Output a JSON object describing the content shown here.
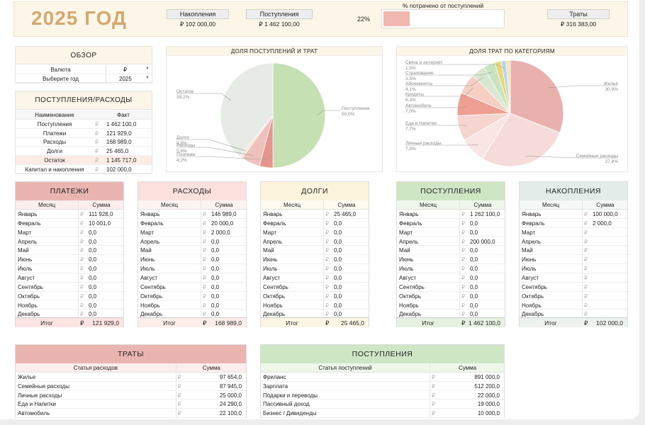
{
  "header": {
    "year_title": "2025 ГОД",
    "savings_label": "Накопления",
    "savings_value": "₽ 102 000,00",
    "income_label": "Поступления",
    "income_value": "₽ 1 462 100,00",
    "pct_value": "22%",
    "pct_label": "% потрачено от поступлений",
    "pct_fraction": 0.22,
    "spend_label": "Траты",
    "spend_value": "₽ 316 383,00"
  },
  "overview": {
    "title": "ОБЗОР",
    "currency_label": "Валюта",
    "currency_value": "₽",
    "year_label": "Выберите год",
    "year_value": "2025"
  },
  "summary": {
    "title": "ПОСТУПЛЕНИЯ/РАСХОДЫ",
    "col_name": "Наименование",
    "col_fact": "Факт",
    "cur": "₽",
    "rows": [
      {
        "name": "Поступления",
        "value": "1 462 100,0"
      },
      {
        "name": "Платежи",
        "value": "121 929,0"
      },
      {
        "name": "Расходы",
        "value": "168 989,0"
      },
      {
        "name": "Долги",
        "value": "25 465,0"
      },
      {
        "name": "Остаток",
        "value": "1 145 717,0"
      },
      {
        "name": "Капитал и накопления",
        "value": "102 000,0"
      }
    ]
  },
  "pie1": {
    "title": "ДОЛЯ ПОСТУПЛЕНИЙ И ТРАТ",
    "slices": [
      {
        "name": "Поступления",
        "pct": "50,0%",
        "value": 50.0,
        "color": "#c5e0b3"
      },
      {
        "name": "Платежи",
        "pct": "4,2%",
        "value": 4.2,
        "color": "#e4958f"
      },
      {
        "name": "Расходы",
        "pct": "5,8%",
        "value": 5.8,
        "color": "#f0c1bb"
      },
      {
        "name": "Долги",
        "pct": "0,9%",
        "value": 0.9,
        "color": "#f7e3d8"
      },
      {
        "name": "Остаток",
        "pct": "39,2%",
        "value": 39.2,
        "color": "#e6ebe6"
      }
    ]
  },
  "pie2": {
    "title": "ДОЛЯ ТРАТ ПО КАТЕГОРИЯМ",
    "slices": [
      {
        "name": "Жильё",
        "pct": "30,9%",
        "value": 30.9,
        "color": "#e8b1ad"
      },
      {
        "name": "Семейные расходы",
        "pct": "27,8%",
        "value": 27.8,
        "color": "#f5dcdb"
      },
      {
        "name": "Личные расходы",
        "pct": "7,9%",
        "value": 7.9,
        "color": "#f9e5e3"
      },
      {
        "name": "Еда и Напитки",
        "pct": "7,7%",
        "value": 7.7,
        "color": "#f6d4d0"
      },
      {
        "name": "Автомобиль",
        "pct": "7,0%",
        "value": 7.0,
        "color": "#ee9f92"
      },
      {
        "name": "Кредиты",
        "pct": "6,3%",
        "value": 6.3,
        "color": "#f4cfc2"
      },
      {
        "name": "Абонементы",
        "pct": "4,1%",
        "value": 4.1,
        "color": "#d8e8d0"
      },
      {
        "name": "Страхование",
        "pct": "3,5%",
        "value": 3.5,
        "color": "#c9e2c0"
      },
      {
        "name": "",
        "pct": "",
        "value": 2.0,
        "color": "#e9d77a"
      },
      {
        "name": "Связь и интернет",
        "pct": "1,5%",
        "value": 1.5,
        "color": "#b8d4ea"
      },
      {
        "name": "",
        "pct": "",
        "value": 1.3,
        "color": "#f1e6b5"
      }
    ]
  },
  "months_col": "Месяц",
  "sum_col": "Сумма",
  "total_label": "Итог",
  "cur": "₽",
  "tables": [
    {
      "title": "ПЛАТЕЖИ",
      "color": "#eab5b1",
      "thcolor": "#fbeeed",
      "totcolor": "#fbe4e2",
      "rows": [
        [
          "Январь",
          "111 928,0"
        ],
        [
          "Февраль",
          "10 001,0"
        ],
        [
          "Март",
          "0,0"
        ],
        [
          "Апрель",
          "0,0"
        ],
        [
          "Май",
          "0,0"
        ],
        [
          "Июнь",
          "0,0"
        ],
        [
          "Июль",
          "0,0"
        ],
        [
          "Август",
          "0,0"
        ],
        [
          "Сентябрь",
          "0,0"
        ],
        [
          "Октябрь",
          "0,0"
        ],
        [
          "Ноябрь",
          "0,0"
        ],
        [
          "Декабрь",
          "0,0"
        ]
      ],
      "total": "121 929,0"
    },
    {
      "title": "РАСХОДЫ",
      "color": "#fbe1dd",
      "thcolor": "#fdf4f2",
      "totcolor": "#fdeeea",
      "rows": [
        [
          "Январь",
          "146 989,0"
        ],
        [
          "Февраль",
          "20 000,0"
        ],
        [
          "Март",
          "2 000,0"
        ],
        [
          "Апрель",
          "0,0"
        ],
        [
          "Май",
          "0,0"
        ],
        [
          "Июнь",
          "0,0"
        ],
        [
          "Июль",
          "0,0"
        ],
        [
          "Август",
          "0,0"
        ],
        [
          "Сентябрь",
          "0,0"
        ],
        [
          "Октябрь",
          "0,0"
        ],
        [
          "Ноябрь",
          "0,0"
        ],
        [
          "Декабрь",
          "0,0"
        ]
      ],
      "total": "168 989,0"
    },
    {
      "title": "ДОЛГИ",
      "color": "#fcf3dc",
      "thcolor": "#fefaf0",
      "totcolor": "#fdf5e4",
      "rows": [
        [
          "Январь",
          "25 465,0"
        ],
        [
          "Февраль",
          "0,0"
        ],
        [
          "Март",
          "0,0"
        ],
        [
          "Апрель",
          "0,0"
        ],
        [
          "Май",
          "0,0"
        ],
        [
          "Июнь",
          "0,0"
        ],
        [
          "Июль",
          "0,0"
        ],
        [
          "Август",
          "0,0"
        ],
        [
          "Сентябрь",
          "0,0"
        ],
        [
          "Октябрь",
          "0,0"
        ],
        [
          "Ноябрь",
          "0,0"
        ],
        [
          "Декабрь",
          "0,0"
        ]
      ],
      "total": "25 465,0"
    },
    {
      "title": "ПОСТУПЛЕНИЯ",
      "color": "#cfe6c4",
      "thcolor": "#eef7ea",
      "totcolor": "#e6f1e0",
      "rows": [
        [
          "Январь",
          "1 262 100,0"
        ],
        [
          "Февраль",
          "0,0"
        ],
        [
          "Март",
          "0,0"
        ],
        [
          "Апрель",
          "200 000,0"
        ],
        [
          "Май",
          "0,0"
        ],
        [
          "Июнь",
          "0,0"
        ],
        [
          "Июль",
          "0,0"
        ],
        [
          "Август",
          "0,0"
        ],
        [
          "Сентябрь",
          "0,0"
        ],
        [
          "Октябрь",
          "0,0"
        ],
        [
          "Ноябрь",
          "0,0"
        ],
        [
          "Декабрь",
          "0,0"
        ]
      ],
      "total": "1 462 100,0"
    },
    {
      "title": "НАКОПЛЕНИЯ",
      "color": "#e3ece8",
      "thcolor": "#f4f8f6",
      "totcolor": "#edf2ef",
      "rows": [
        [
          "Январь",
          "100 000,0"
        ],
        [
          "Февраль",
          "2 000,0"
        ],
        [
          "Март",
          ""
        ],
        [
          "Апрель",
          ""
        ],
        [
          "Май",
          ""
        ],
        [
          "Июнь",
          ""
        ],
        [
          "Июль",
          ""
        ],
        [
          "Август",
          ""
        ],
        [
          "Сентябрь",
          ""
        ],
        [
          "Октябрь",
          ""
        ],
        [
          "Ноябрь",
          ""
        ],
        [
          "Декабрь",
          ""
        ]
      ],
      "total": "102 000,0"
    }
  ],
  "spend": {
    "title": "ТРАТЫ",
    "col_item": "Статья расходов",
    "col_sum": "Сумма",
    "rows": [
      [
        "Жилье",
        "97 654,0"
      ],
      [
        "Семейные расходы",
        "87 945,0"
      ],
      [
        "Личные расходы",
        "25 000,0"
      ],
      [
        "Еда и Напитки",
        "24 290,0"
      ],
      [
        "Автомобиль",
        "22 100,0"
      ]
    ]
  },
  "incomes": {
    "title": "ПОСТУПЛЕНИЯ",
    "col_item": "Статья поступлений",
    "col_sum": "Сумма",
    "rows": [
      [
        "Фриланс",
        "891 000,0"
      ],
      [
        "Зарплата",
        "512 200,0"
      ],
      [
        "Подарки и переводы",
        "22 000,0"
      ],
      [
        "Пассивный доход",
        "19 000,0"
      ],
      [
        "Бизнес / Дивиденды",
        "10 000,0"
      ]
    ]
  }
}
